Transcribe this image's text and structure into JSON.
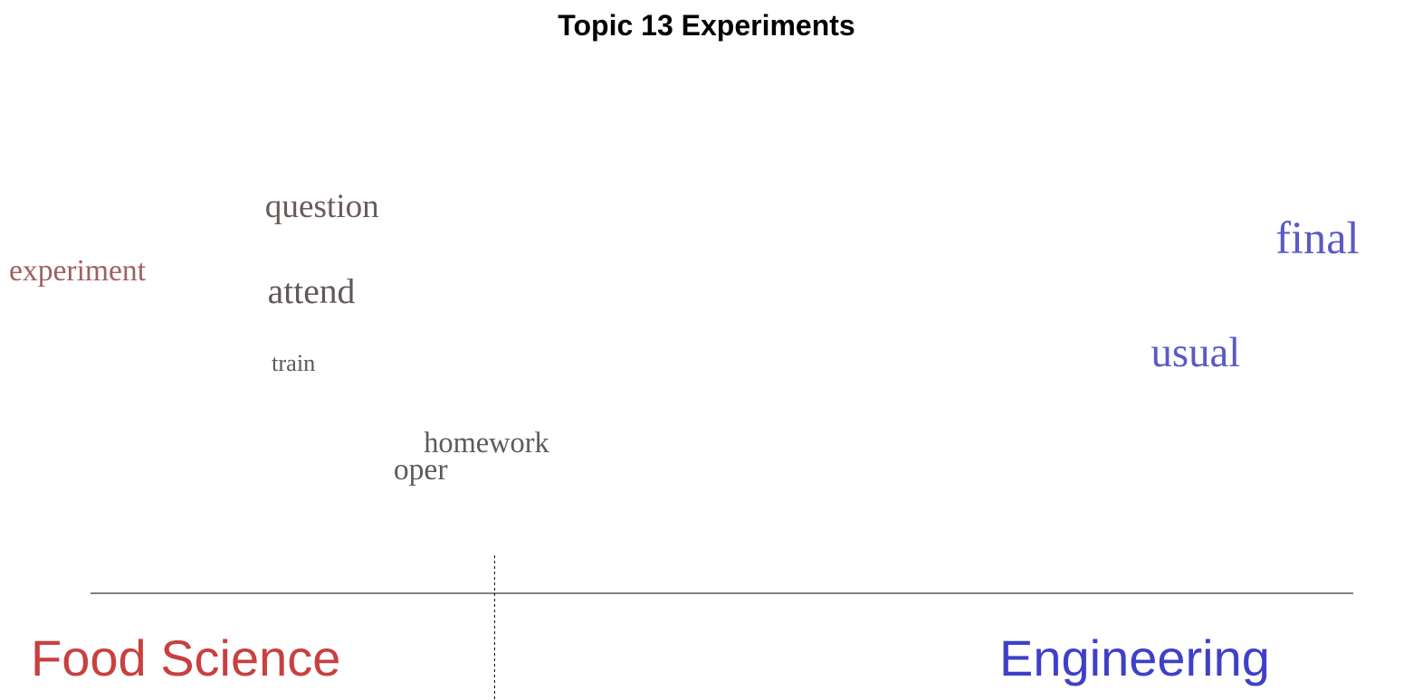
{
  "chart_data": {
    "type": "scatter",
    "title": "Topic 13 Experiments",
    "x_axis": {
      "left_label": "Food Science",
      "right_label": "Engineering",
      "left_color": "#c8403f",
      "right_color": "#3f40c8",
      "xlim": [
        0,
        1
      ],
      "midpoint": 0.32
    },
    "y_axis": {
      "ylim": [
        0,
        1
      ]
    },
    "grid": false,
    "legend": "none",
    "words": [
      {
        "text": "question",
        "x": 0.195,
        "y": 0.76,
        "size": 1.55,
        "color": "#6a5a5a"
      },
      {
        "text": "experiment",
        "x": 0.0,
        "y": 0.62,
        "size": 1.4,
        "color": "#a06060"
      },
      {
        "text": "attend",
        "x": 0.197,
        "y": 0.57,
        "size": 1.65,
        "color": "#625858"
      },
      {
        "text": "train",
        "x": 0.2,
        "y": 0.42,
        "size": 1.1,
        "color": "#5f5858"
      },
      {
        "text": "homework",
        "x": 0.316,
        "y": 0.24,
        "size": 1.35,
        "color": "#5e5a5a"
      },
      {
        "text": "oper",
        "x": 0.293,
        "y": 0.18,
        "size": 1.4,
        "color": "#5e5a5a"
      },
      {
        "text": "final",
        "x": 0.965,
        "y": 0.68,
        "size": 2.1,
        "color": "#5a5ac8"
      },
      {
        "text": "usual",
        "x": 0.87,
        "y": 0.43,
        "size": 1.95,
        "color": "#5a5ac8"
      }
    ]
  }
}
